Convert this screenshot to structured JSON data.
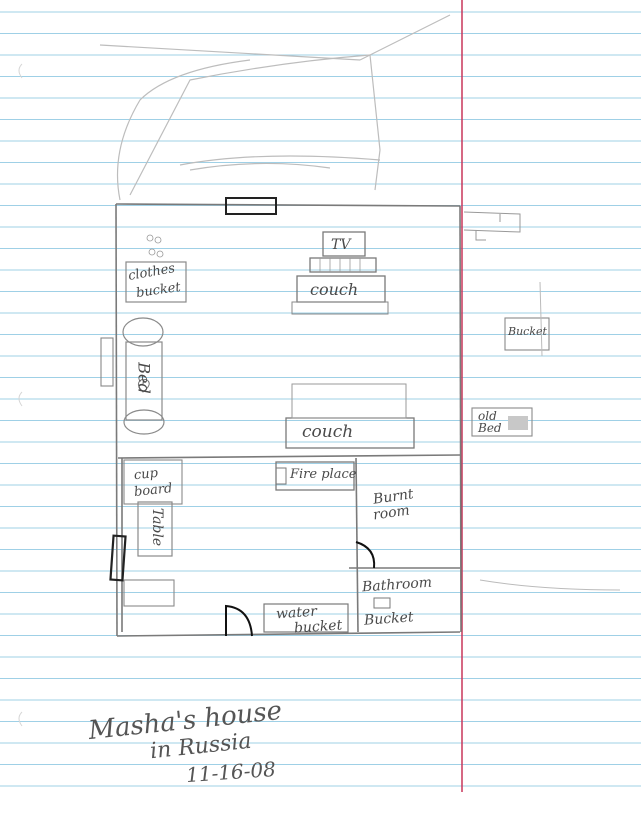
{
  "labels": {
    "tv": "TV",
    "couch_top": "couch",
    "clothes": "clothes",
    "bucket_left": "bucket",
    "bed": "Bed",
    "couch_middle": "couch",
    "cupboard_1": "cup",
    "cupboard_2": "board",
    "table": "Table",
    "fireplace": "Fire place",
    "burnt_1": "Burnt",
    "burnt_2": "room",
    "bathroom": "Bathroom",
    "bucket_bath": "Bucket",
    "water_1": "water",
    "water_2": "bucket",
    "bucket_right": "Bucket",
    "old": "old",
    "bed_right": "Bed"
  },
  "caption": {
    "line1": "Masha's house",
    "line2": "in Russia",
    "date": "11-16-08"
  },
  "colors": {
    "rule_line": "#9fd0e6",
    "margin_line": "#c8365a",
    "pencil": "#7a7a7a",
    "dark_pencil": "#222222"
  }
}
